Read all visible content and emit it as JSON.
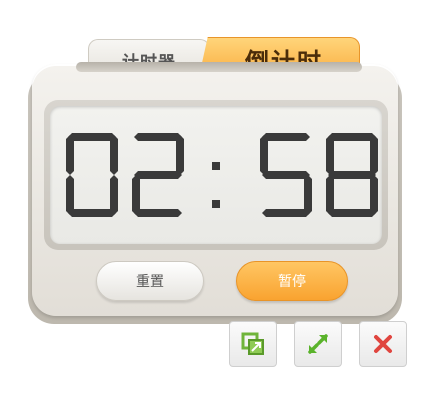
{
  "tabs": {
    "timer_label": "计时器",
    "countdown_label": "倒计时",
    "active": "countdown"
  },
  "display": {
    "minutes": "02",
    "seconds": "58",
    "separator": ":"
  },
  "buttons": {
    "reset_label": "重置",
    "pause_label": "暂停"
  },
  "window_controls": [
    {
      "name": "restore-icon",
      "color": "#6fb43a"
    },
    {
      "name": "expand-icon",
      "color": "#5ab32b"
    },
    {
      "name": "close-icon",
      "color": "#e0453f"
    }
  ],
  "colors": {
    "accent": "#f9a93a",
    "digit": "#3a3a3a",
    "screen": "#efefec"
  }
}
